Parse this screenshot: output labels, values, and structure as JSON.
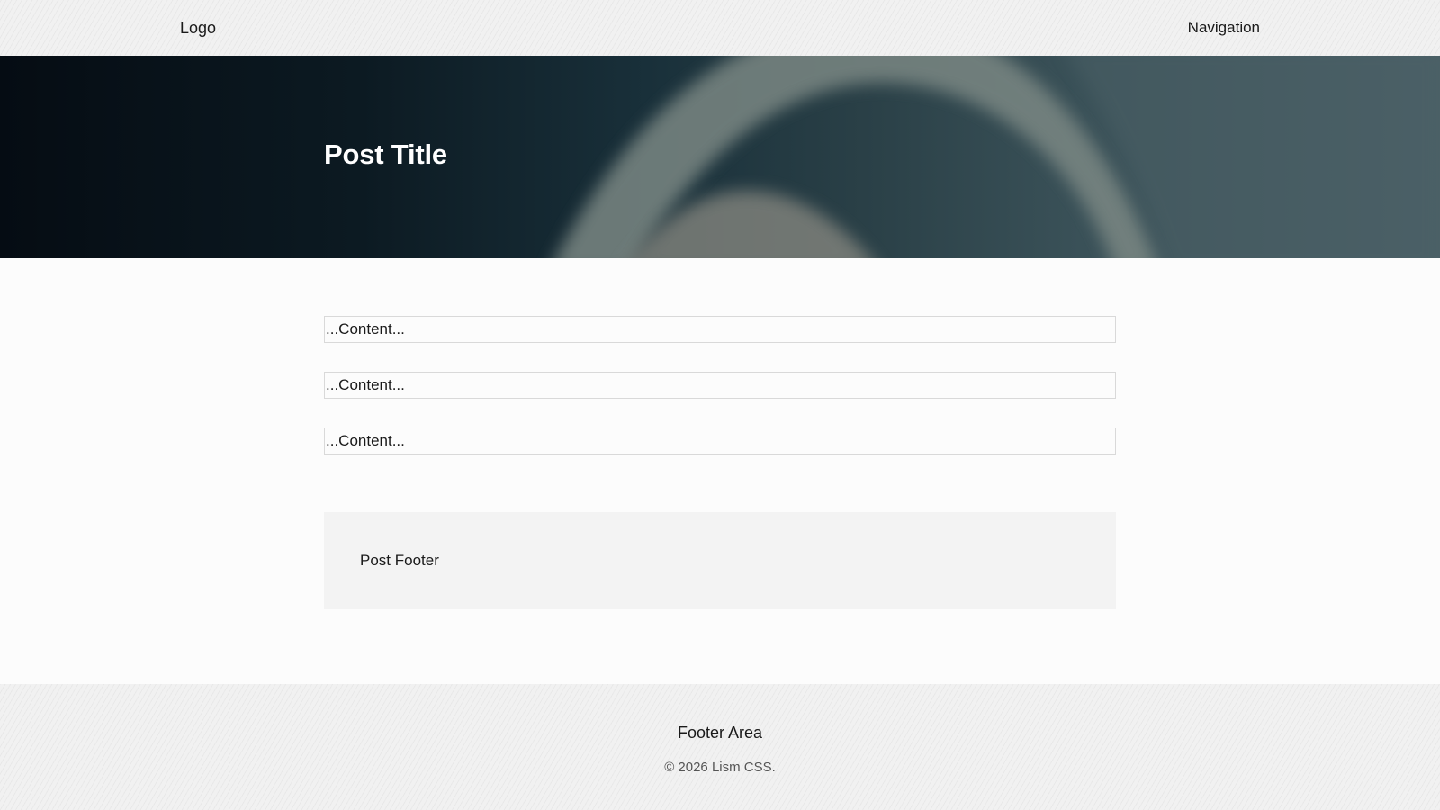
{
  "header": {
    "logo": "Logo",
    "navigation": "Navigation"
  },
  "hero": {
    "title": "Post Title"
  },
  "content": {
    "items": [
      "...Content...",
      "...Content...",
      "...Content..."
    ]
  },
  "post_footer": {
    "label": "Post Footer"
  },
  "footer": {
    "title": "Footer Area",
    "copyright": "© 2026 Lism CSS."
  }
}
